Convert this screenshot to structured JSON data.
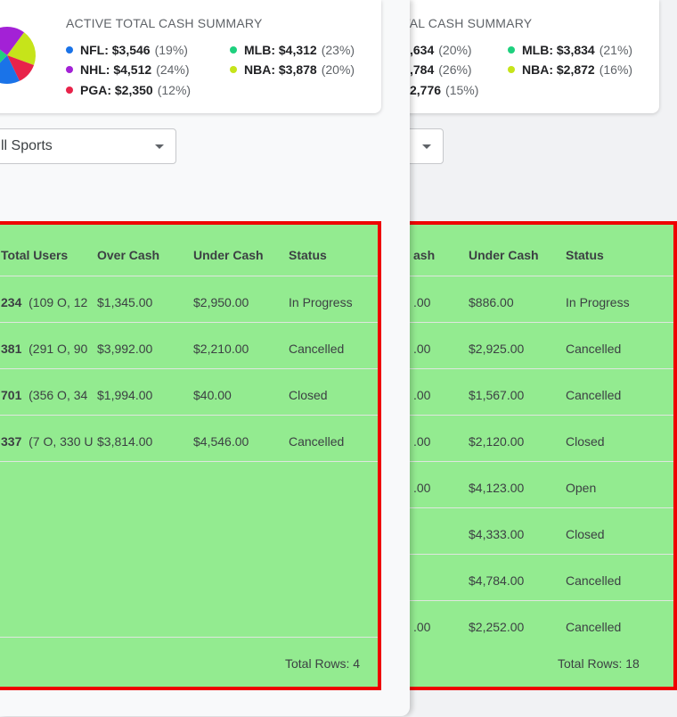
{
  "front": {
    "summary_title": "ACTIVE TOTAL CASH SUMMARY",
    "legend": [
      {
        "label": "NFL: $3,546",
        "pct": "(19%)",
        "color": "#1a73e8"
      },
      {
        "label": "MLB: $4,312",
        "pct": "(23%)",
        "color": "#1ed07e"
      },
      {
        "label": "NHL: $4,512",
        "pct": "(24%)",
        "color": "#a321d6"
      },
      {
        "label": "NBA: $3,878",
        "pct": "(20%)",
        "color": "#c6e41a"
      },
      {
        "label": "PGA: $2,350",
        "pct": "(12%)",
        "color": "#e8234a"
      }
    ],
    "filter_value": "ll Sports",
    "headers": {
      "total_users": "Total Users",
      "over_cash": "Over Cash",
      "under_cash": "Under Cash",
      "status": "Status"
    },
    "rows": [
      {
        "users_total": "234",
        "users_detail": "(109 O, 12",
        "over": "$1,345.00",
        "under": "$2,950.00",
        "status": "In Progress"
      },
      {
        "users_total": "381",
        "users_detail": "(291 O, 90",
        "over": "$3,992.00",
        "under": "$2,210.00",
        "status": "Cancelled"
      },
      {
        "users_total": "701",
        "users_detail": "(356 O, 34",
        "over": "$1,994.00",
        "under": "$40.00",
        "status": "Closed"
      },
      {
        "users_total": "337",
        "users_detail": "(7 O, 330 U",
        "over": "$3,814.00",
        "under": "$4,546.00",
        "status": "Cancelled"
      }
    ],
    "total_rows": "Total Rows: 4"
  },
  "back": {
    "summary_title": "TAL CASH SUMMARY",
    "legend": [
      {
        "label": ",634",
        "pct": "(20%)",
        "color": ""
      },
      {
        "label": "MLB: $3,834",
        "pct": "(21%)",
        "color": "#1ed07e"
      },
      {
        "label": ",784",
        "pct": "(26%)",
        "color": ""
      },
      {
        "label": "NBA: $2,872",
        "pct": "(16%)",
        "color": "#c6e41a"
      },
      {
        "label": "2,776",
        "pct": "(15%)",
        "color": ""
      }
    ],
    "headers": {
      "over_cash_partial": "ash",
      "under_cash": "Under Cash",
      "status": "Status"
    },
    "rows": [
      {
        "over": ".00",
        "under": "$886.00",
        "status": "In Progress"
      },
      {
        "over": ".00",
        "under": "$2,925.00",
        "status": "Cancelled"
      },
      {
        "over": ".00",
        "under": "$1,567.00",
        "status": "Cancelled"
      },
      {
        "over": ".00",
        "under": "$2,120.00",
        "status": "Closed"
      },
      {
        "over": ".00",
        "under": "$4,123.00",
        "status": "Open"
      },
      {
        "over": "",
        "under": "$4,333.00",
        "status": "Closed"
      },
      {
        "over": "",
        "under": "$4,784.00",
        "status": "Cancelled"
      },
      {
        "over": ".00",
        "under": "$2,252.00",
        "status": "Cancelled"
      }
    ],
    "total_rows": "Total Rows: 18"
  }
}
